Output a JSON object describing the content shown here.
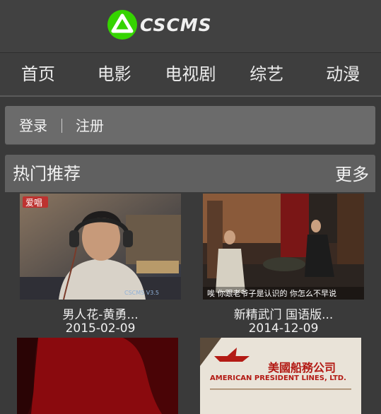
{
  "logo": {
    "text": "CSCMS",
    "icon": "cscms-logo-icon",
    "accent": "#35d400"
  },
  "nav": {
    "items": [
      {
        "label": "首页"
      },
      {
        "label": "电影"
      },
      {
        "label": "电视剧"
      },
      {
        "label": "综艺"
      },
      {
        "label": "动漫"
      }
    ]
  },
  "user": {
    "login": "登录",
    "register": "注册"
  },
  "hot": {
    "title": "热门推荐",
    "more": "更多",
    "items": [
      {
        "title": "男人花-黄勇...",
        "date": "2015-02-09",
        "thumb_badge": "爱唱",
        "thumb_watermark": "CSCMS V3.5"
      },
      {
        "title": "新精武门 国语版...",
        "date": "2014-12-09",
        "thumb_caption": "唉 你跟老爷子是认识的 你怎么不早说"
      },
      {
        "title": "",
        "date": ""
      },
      {
        "title": "",
        "date": "",
        "thumb_text": "美國船務公司",
        "thumb_subtext": "AMERICAN PRESIDENT LINES, LTD."
      }
    ]
  }
}
